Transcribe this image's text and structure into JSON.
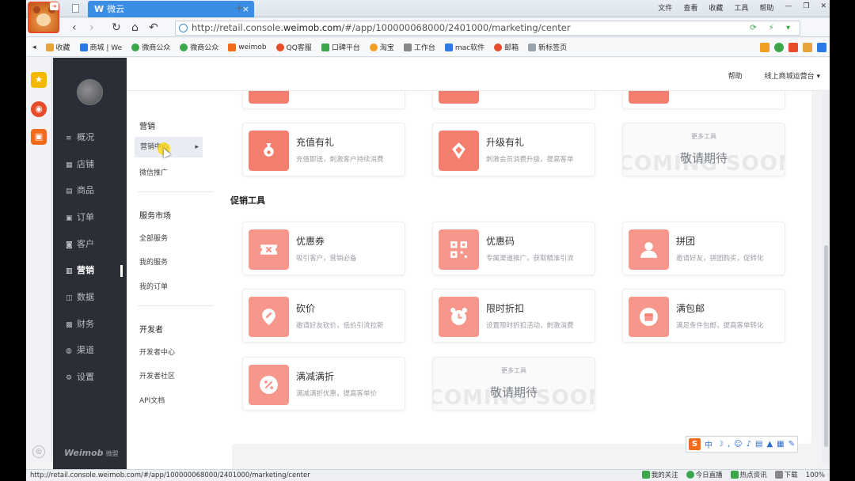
{
  "browser": {
    "tab_title": "W 微云",
    "tab_prefix": "W",
    "tab_name": "微云",
    "url_prefix": "http://retail.console.",
    "url_domain": "weimob.com",
    "url_suffix": "/#/app/100000068000/2401000/marketing/center",
    "menu": [
      "文件",
      "查看",
      "收藏",
      "工具",
      "帮助"
    ],
    "bookmarks": [
      {
        "label": "收藏",
        "color": "#e8a33b"
      },
      {
        "label": "商城 | We",
        "color": "#2c7be5"
      },
      {
        "label": "微商公众",
        "color": "#3aa84a"
      },
      {
        "label": "微商公众",
        "color": "#3aa84a"
      },
      {
        "label": "weimob",
        "color": "#f26b1d"
      },
      {
        "label": "QQ客服",
        "color": "#e64b2a"
      },
      {
        "label": "口碑平台",
        "color": "#3aa84a"
      },
      {
        "label": "淘宝",
        "color": "#f0a020"
      },
      {
        "label": "工作台",
        "color": "#888888"
      },
      {
        "label": "mac软件",
        "color": "#2c7be5"
      },
      {
        "label": "邮箱",
        "color": "#e64b2a"
      },
      {
        "label": "新标签页",
        "color": "#9aa3ad"
      }
    ],
    "status_url": "http://retail.console.weimob.com/#/app/100000068000/2401000/marketing/center",
    "status_items": [
      "我的关注",
      "今日直播",
      "热点资讯",
      "下载",
      "100%"
    ]
  },
  "header": {
    "right_items": [
      "帮助",
      "线上商城运营台"
    ]
  },
  "nav": {
    "items": [
      {
        "icon": "≡",
        "label": "概况"
      },
      {
        "icon": "▦",
        "label": "店铺"
      },
      {
        "icon": "▤",
        "label": "商品"
      },
      {
        "icon": "▣",
        "label": "订单"
      },
      {
        "icon": "◙",
        "label": "客户"
      },
      {
        "icon": "▥",
        "label": "营销"
      },
      {
        "icon": "◫",
        "label": "数据"
      },
      {
        "icon": "▩",
        "label": "财务"
      },
      {
        "icon": "◍",
        "label": "渠道"
      },
      {
        "icon": "⚙",
        "label": "设置"
      }
    ],
    "active_index": 5,
    "brand": "Weimob",
    "brand_sub": "微盟"
  },
  "submenu": {
    "group1_title": "营销",
    "group1_items": [
      "营销中心",
      "微信推广"
    ],
    "group2_title": "服务市场",
    "group2_items": [
      "全部服务",
      "我的服务",
      "我的订单"
    ],
    "group3_title": "开发者",
    "group3_items": [
      "开发者中心",
      "开发者社区",
      "API文档"
    ]
  },
  "main": {
    "top_cards": [
      {
        "title": "充值有礼",
        "desc": "充值即送，刺激客户持续消费"
      },
      {
        "title": "升级有礼",
        "desc": "刺激会员消费升级，提高客单"
      }
    ],
    "top_soon": {
      "label": "更多工具",
      "main": "敬请期待",
      "watermark": "COMING SOON"
    },
    "section_title": "促销工具",
    "promo_cards": [
      {
        "title": "优惠券",
        "desc": "吸引客户，营销必备"
      },
      {
        "title": "优惠码",
        "desc": "专属渠道推广，获取精准引流"
      },
      {
        "title": "拼团",
        "desc": "邀请好友，拼团购买，促转化"
      },
      {
        "title": "砍价",
        "desc": "邀请好友砍价，低价引流拉新"
      },
      {
        "title": "限时折扣",
        "desc": "设置限时折扣活动，刺激消费"
      },
      {
        "title": "满包邮",
        "desc": "满足条件包邮，提高客单转化"
      },
      {
        "title": "满减满折",
        "desc": "满减满折优惠，提高客单价"
      }
    ],
    "bottom_soon": {
      "label": "更多工具",
      "main": "敬请期待",
      "watermark": "COMING SOON"
    }
  },
  "ime": {
    "logo": "S",
    "mode": "中"
  },
  "colors": {
    "accent": "#f47e6e",
    "nav_bg": "#2a2e36",
    "tab_blue": "#3a8ee6"
  }
}
